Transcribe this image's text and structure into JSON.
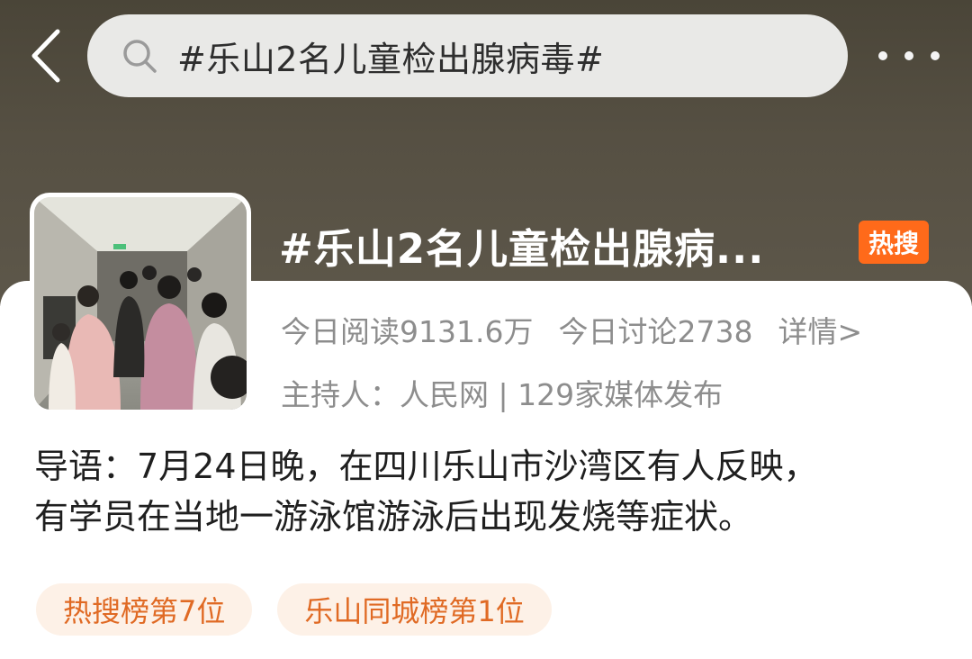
{
  "colors": {
    "header_background": "#565043",
    "hot_badge": "#ff6a1a",
    "tag_text": "#e06a24",
    "tag_background": "#fdf1e7",
    "meta_text": "#8d8d8d"
  },
  "header": {
    "back_icon": "chevron-left-icon",
    "search_icon": "search-icon",
    "search_text": "#乐山2名儿童检出腺病毒#",
    "more_icon": "more-dots-icon"
  },
  "topic": {
    "title": "#乐山2名儿童检出腺病...",
    "hot_badge": "热搜",
    "reads_today": "今日阅读9131.6万",
    "discussions_today": "今日讨论2738",
    "details_link": "详情>",
    "host": "主持人：人民网 | 129家媒体发布"
  },
  "intro": {
    "line1": "导语：7月24日晚，在四川乐山市沙湾区有人反映，",
    "line2": "有学员在当地一游泳馆游泳后出现发烧等症状。"
  },
  "tags": [
    {
      "label": "热搜榜第7位"
    },
    {
      "label": "乐山同城榜第1位"
    }
  ]
}
